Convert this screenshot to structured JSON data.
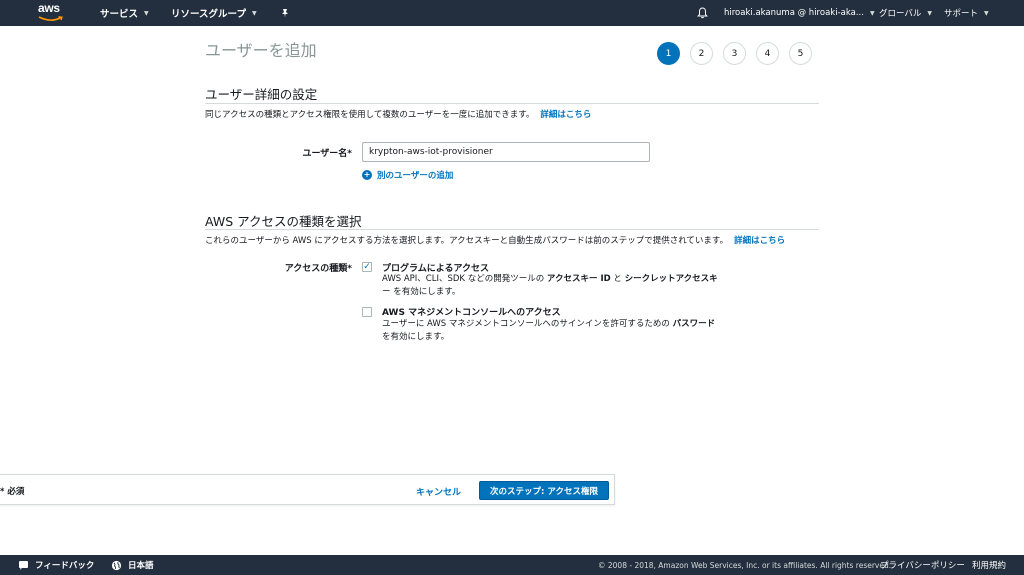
{
  "topnav": {
    "logo_text": "aws",
    "services": "サービス",
    "resource_groups": "リソースグループ",
    "account": "hiroaki.akanuma @ hiroaki-aka...",
    "region": "グローバル",
    "support": "サポート"
  },
  "page": {
    "title": "ユーザーを追加",
    "steps": [
      "1",
      "2",
      "3",
      "4",
      "5"
    ],
    "active_step": 1
  },
  "user_details": {
    "heading": "ユーザー詳細の設定",
    "description": "同じアクセスの種類とアクセス権限を使用して複数のユーザーを一度に追加できます。",
    "learn_more": "詳細はこちら",
    "username_label": "ユーザー名*",
    "username_value": "krypton-aws-iot-provisioner",
    "add_another": "別のユーザーの追加"
  },
  "access_type": {
    "heading": "AWS アクセスの種類を選択",
    "description": "これらのユーザーから AWS にアクセスする方法を選択します。アクセスキーと自動生成パスワードは前のステップで提供されています。",
    "learn_more": "詳細はこちら",
    "label": "アクセスの種類*",
    "programmatic": {
      "title": "プログラムによるアクセス",
      "checked": true,
      "desc_1": "AWS API、CLI、SDK などの開発ツールの",
      "desc_bold_1": "アクセスキー ID",
      "desc_2": "と",
      "desc_bold_2": "シークレットアクセスキ",
      "desc_line2": "ー を有効にします。"
    },
    "console": {
      "title": "AWS マネジメントコンソールへのアクセス",
      "checked": false,
      "desc_1": "ユーザーに AWS マネジメントコンソールへのサインインを許可するための",
      "desc_bold": "パスワード",
      "desc_line2": "を有効にします。"
    }
  },
  "actions": {
    "required_note": "* 必須",
    "cancel": "キャンセル",
    "next": "次のステップ: アクセス権限"
  },
  "footer": {
    "feedback": "フィードバック",
    "language": "日本語",
    "copyright": "© 2008 - 2018, Amazon Web Services, Inc. or its affiliates. All rights reserved.",
    "privacy": "プライバシーポリシー",
    "terms": "利用規約"
  },
  "colors": {
    "nav_bg": "#232f3e",
    "accent": "#0073bb",
    "muted_title": "#879596"
  }
}
